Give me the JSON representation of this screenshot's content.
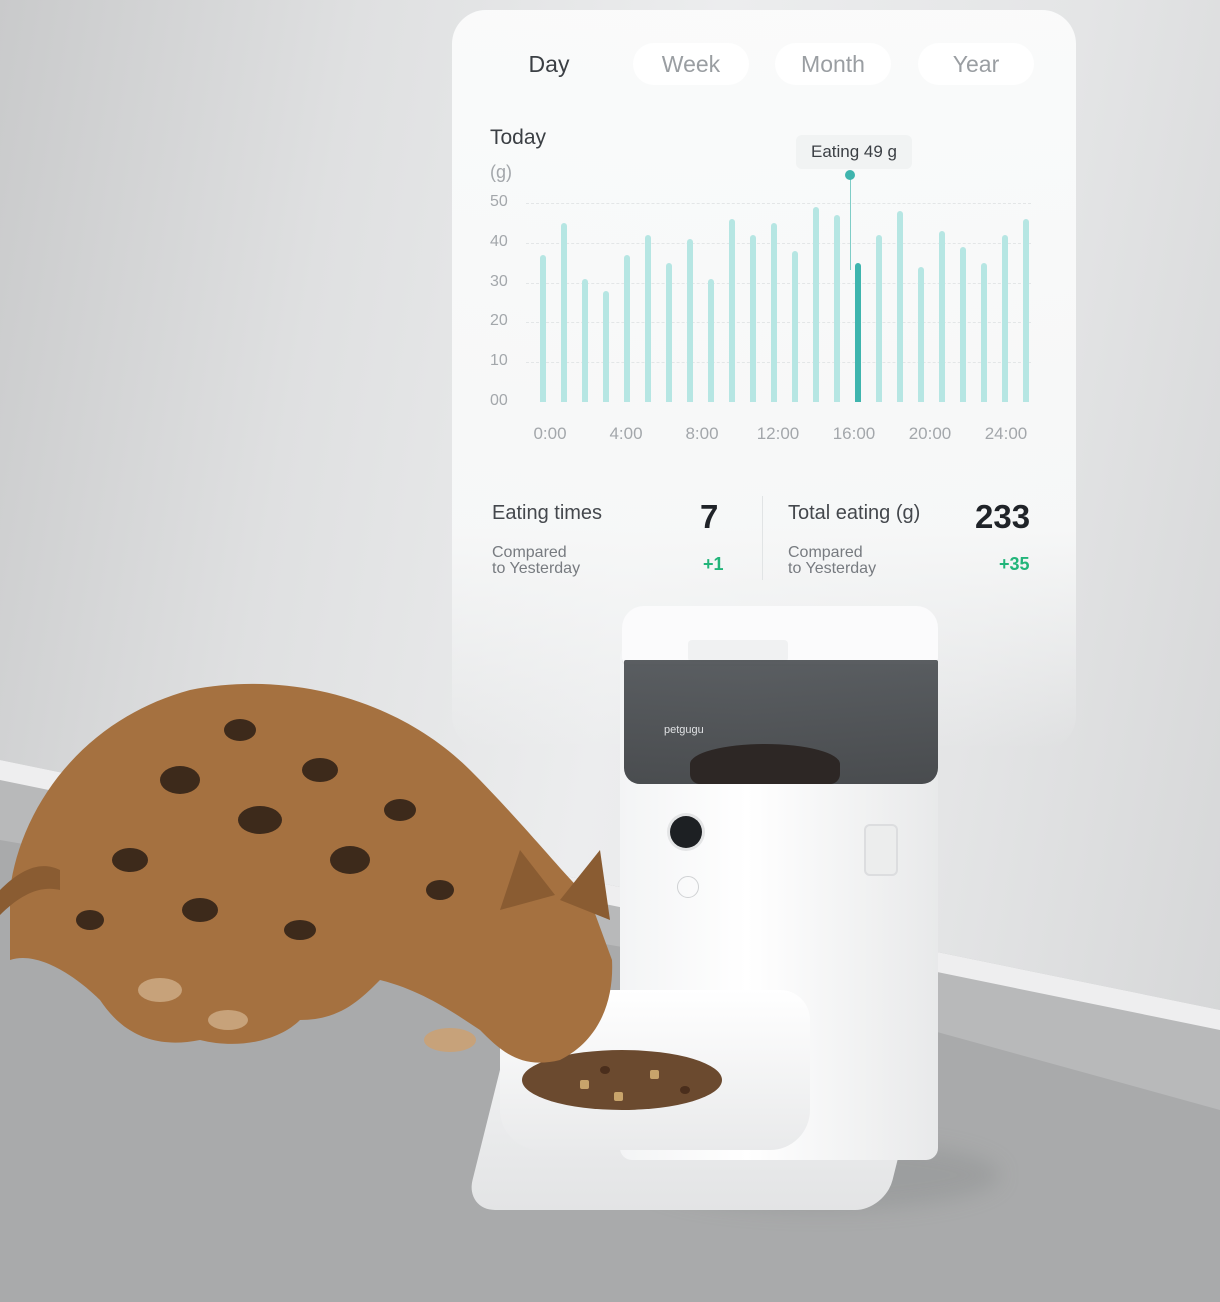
{
  "tabs": [
    {
      "label": "Day",
      "active": true
    },
    {
      "label": "Week",
      "active": false
    },
    {
      "label": "Month",
      "active": false
    },
    {
      "label": "Year",
      "active": false
    }
  ],
  "chart": {
    "title": "Today",
    "unit": "(g)",
    "tooltip": "Eating 49 g"
  },
  "chart_data": {
    "type": "bar",
    "title": "Today",
    "ylabel": "(g)",
    "ylim": [
      0,
      50
    ],
    "ytick_labels": [
      "50",
      "40",
      "30",
      "20",
      "10",
      "00"
    ],
    "xtick_labels": [
      "0:00",
      "4:00",
      "8:00",
      "12:00",
      "16:00",
      "20:00",
      "24:00"
    ],
    "x": [
      0,
      1,
      2,
      3,
      4,
      5,
      6,
      7,
      8,
      9,
      10,
      11,
      12,
      13,
      14,
      15,
      16,
      17,
      18,
      19,
      20,
      21,
      22,
      23,
      24
    ],
    "values": [
      37,
      45,
      31,
      28,
      37,
      42,
      35,
      41,
      31,
      46,
      42,
      45,
      38,
      49,
      47,
      35,
      42,
      48,
      34,
      43,
      39,
      35,
      42,
      46,
      0
    ],
    "highlighted_index": 15,
    "highlight_label": "Eating 49 g",
    "grid": true,
    "colors": {
      "bar": "#b6e6e3",
      "highlight": "#3fb5ae"
    }
  },
  "stats": {
    "eating_times": {
      "label": "Eating times",
      "value": "7",
      "compare": "Compared\nto Yesterday",
      "delta": "+1"
    },
    "total_eating": {
      "label": "Total eating (g)",
      "value": "233",
      "compare": "Compared\nto Yesterday",
      "delta": "+35"
    }
  },
  "device": {
    "brand": "petgugu"
  },
  "colors": {
    "accent": "#3fb5ae",
    "positive": "#22b57a"
  }
}
